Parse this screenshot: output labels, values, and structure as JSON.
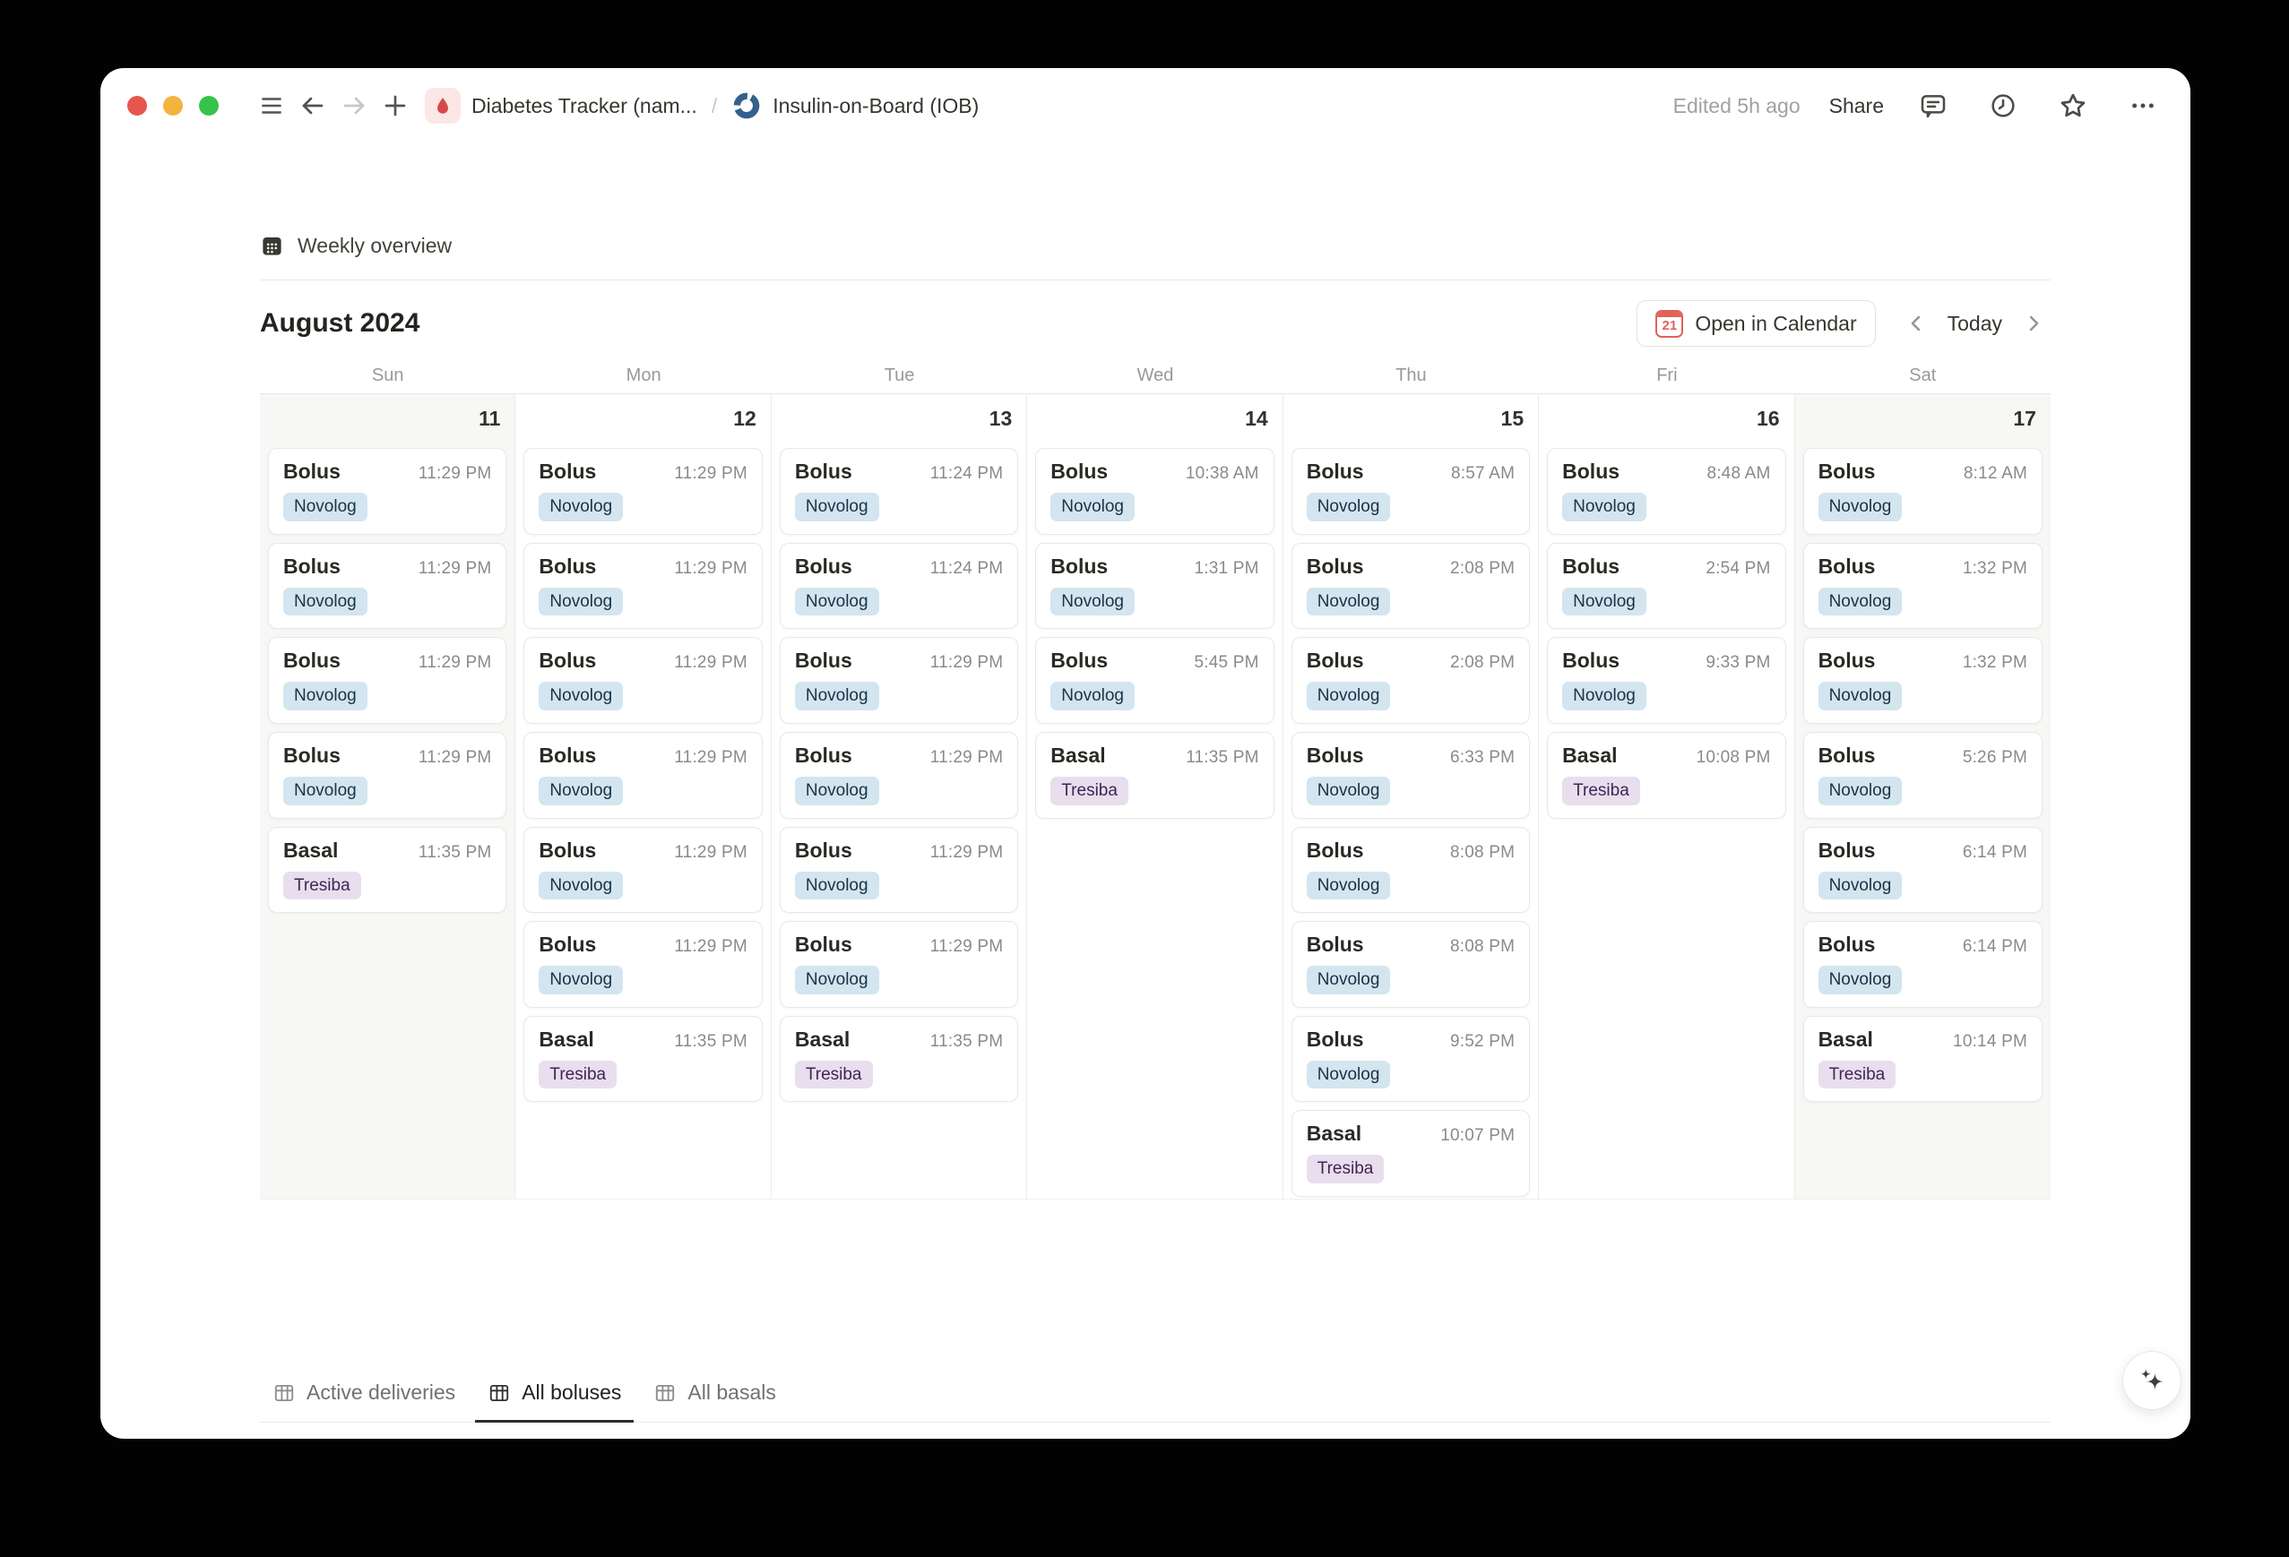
{
  "toolbar": {
    "breadcrumb": [
      {
        "label": "Diabetes Tracker (nam...",
        "icon": "droplet-icon"
      },
      {
        "label": "Insulin-on-Board (IOB)",
        "icon": "pie-chart-icon"
      }
    ],
    "separator": "/",
    "edited": "Edited 5h ago",
    "share_label": "Share"
  },
  "page": {
    "view_title": "Weekly overview",
    "month_title": "August 2024",
    "open_in_calendar_label": "Open in Calendar",
    "calendar_icon_day": "21",
    "today_label": "Today"
  },
  "calendar": {
    "weekdays": [
      "Sun",
      "Mon",
      "Tue",
      "Wed",
      "Thu",
      "Fri",
      "Sat"
    ],
    "days": [
      {
        "date": "11",
        "weekend": true,
        "events": [
          {
            "title": "Bolus",
            "time": "11:29 PM",
            "tag": "Novolog",
            "tag_color": "blue"
          },
          {
            "title": "Bolus",
            "time": "11:29 PM",
            "tag": "Novolog",
            "tag_color": "blue"
          },
          {
            "title": "Bolus",
            "time": "11:29 PM",
            "tag": "Novolog",
            "tag_color": "blue"
          },
          {
            "title": "Bolus",
            "time": "11:29 PM",
            "tag": "Novolog",
            "tag_color": "blue"
          },
          {
            "title": "Basal",
            "time": "11:35 PM",
            "tag": "Tresiba",
            "tag_color": "purple"
          }
        ]
      },
      {
        "date": "12",
        "weekend": false,
        "events": [
          {
            "title": "Bolus",
            "time": "11:29 PM",
            "tag": "Novolog",
            "tag_color": "blue"
          },
          {
            "title": "Bolus",
            "time": "11:29 PM",
            "tag": "Novolog",
            "tag_color": "blue"
          },
          {
            "title": "Bolus",
            "time": "11:29 PM",
            "tag": "Novolog",
            "tag_color": "blue"
          },
          {
            "title": "Bolus",
            "time": "11:29 PM",
            "tag": "Novolog",
            "tag_color": "blue"
          },
          {
            "title": "Bolus",
            "time": "11:29 PM",
            "tag": "Novolog",
            "tag_color": "blue"
          },
          {
            "title": "Bolus",
            "time": "11:29 PM",
            "tag": "Novolog",
            "tag_color": "blue"
          },
          {
            "title": "Basal",
            "time": "11:35 PM",
            "tag": "Tresiba",
            "tag_color": "purple"
          }
        ]
      },
      {
        "date": "13",
        "weekend": false,
        "events": [
          {
            "title": "Bolus",
            "time": "11:24 PM",
            "tag": "Novolog",
            "tag_color": "blue"
          },
          {
            "title": "Bolus",
            "time": "11:24 PM",
            "tag": "Novolog",
            "tag_color": "blue"
          },
          {
            "title": "Bolus",
            "time": "11:29 PM",
            "tag": "Novolog",
            "tag_color": "blue"
          },
          {
            "title": "Bolus",
            "time": "11:29 PM",
            "tag": "Novolog",
            "tag_color": "blue"
          },
          {
            "title": "Bolus",
            "time": "11:29 PM",
            "tag": "Novolog",
            "tag_color": "blue"
          },
          {
            "title": "Bolus",
            "time": "11:29 PM",
            "tag": "Novolog",
            "tag_color": "blue"
          },
          {
            "title": "Basal",
            "time": "11:35 PM",
            "tag": "Tresiba",
            "tag_color": "purple"
          }
        ]
      },
      {
        "date": "14",
        "weekend": false,
        "events": [
          {
            "title": "Bolus",
            "time": "10:38 AM",
            "tag": "Novolog",
            "tag_color": "blue"
          },
          {
            "title": "Bolus",
            "time": "1:31 PM",
            "tag": "Novolog",
            "tag_color": "blue"
          },
          {
            "title": "Bolus",
            "time": "5:45 PM",
            "tag": "Novolog",
            "tag_color": "blue"
          },
          {
            "title": "Basal",
            "time": "11:35 PM",
            "tag": "Tresiba",
            "tag_color": "purple"
          }
        ]
      },
      {
        "date": "15",
        "weekend": false,
        "events": [
          {
            "title": "Bolus",
            "time": "8:57 AM",
            "tag": "Novolog",
            "tag_color": "blue"
          },
          {
            "title": "Bolus",
            "time": "2:08 PM",
            "tag": "Novolog",
            "tag_color": "blue"
          },
          {
            "title": "Bolus",
            "time": "2:08 PM",
            "tag": "Novolog",
            "tag_color": "blue"
          },
          {
            "title": "Bolus",
            "time": "6:33 PM",
            "tag": "Novolog",
            "tag_color": "blue"
          },
          {
            "title": "Bolus",
            "time": "8:08 PM",
            "tag": "Novolog",
            "tag_color": "blue"
          },
          {
            "title": "Bolus",
            "time": "8:08 PM",
            "tag": "Novolog",
            "tag_color": "blue"
          },
          {
            "title": "Bolus",
            "time": "9:52 PM",
            "tag": "Novolog",
            "tag_color": "blue"
          },
          {
            "title": "Basal",
            "time": "10:07 PM",
            "tag": "Tresiba",
            "tag_color": "purple"
          }
        ]
      },
      {
        "date": "16",
        "weekend": false,
        "events": [
          {
            "title": "Bolus",
            "time": "8:48 AM",
            "tag": "Novolog",
            "tag_color": "blue"
          },
          {
            "title": "Bolus",
            "time": "2:54 PM",
            "tag": "Novolog",
            "tag_color": "blue"
          },
          {
            "title": "Bolus",
            "time": "9:33 PM",
            "tag": "Novolog",
            "tag_color": "blue"
          },
          {
            "title": "Basal",
            "time": "10:08 PM",
            "tag": "Tresiba",
            "tag_color": "purple"
          }
        ]
      },
      {
        "date": "17",
        "weekend": true,
        "events": [
          {
            "title": "Bolus",
            "time": "8:12 AM",
            "tag": "Novolog",
            "tag_color": "blue"
          },
          {
            "title": "Bolus",
            "time": "1:32 PM",
            "tag": "Novolog",
            "tag_color": "blue"
          },
          {
            "title": "Bolus",
            "time": "1:32 PM",
            "tag": "Novolog",
            "tag_color": "blue"
          },
          {
            "title": "Bolus",
            "time": "5:26 PM",
            "tag": "Novolog",
            "tag_color": "blue"
          },
          {
            "title": "Bolus",
            "time": "6:14 PM",
            "tag": "Novolog",
            "tag_color": "blue"
          },
          {
            "title": "Bolus",
            "time": "6:14 PM",
            "tag": "Novolog",
            "tag_color": "blue"
          },
          {
            "title": "Basal",
            "time": "10:14 PM",
            "tag": "Tresiba",
            "tag_color": "purple"
          }
        ]
      }
    ]
  },
  "tabs": [
    {
      "label": "Active deliveries",
      "active": false
    },
    {
      "label": "All boluses",
      "active": true
    },
    {
      "label": "All basals",
      "active": false
    }
  ],
  "colors": {
    "novolog_bg": "#d3e5ef",
    "novolog_text": "#183347",
    "tresiba_bg": "#e8deee",
    "tresiba_text": "#412454",
    "calendar_accent": "#e16259",
    "weekend_bg": "#f7f7f5"
  }
}
